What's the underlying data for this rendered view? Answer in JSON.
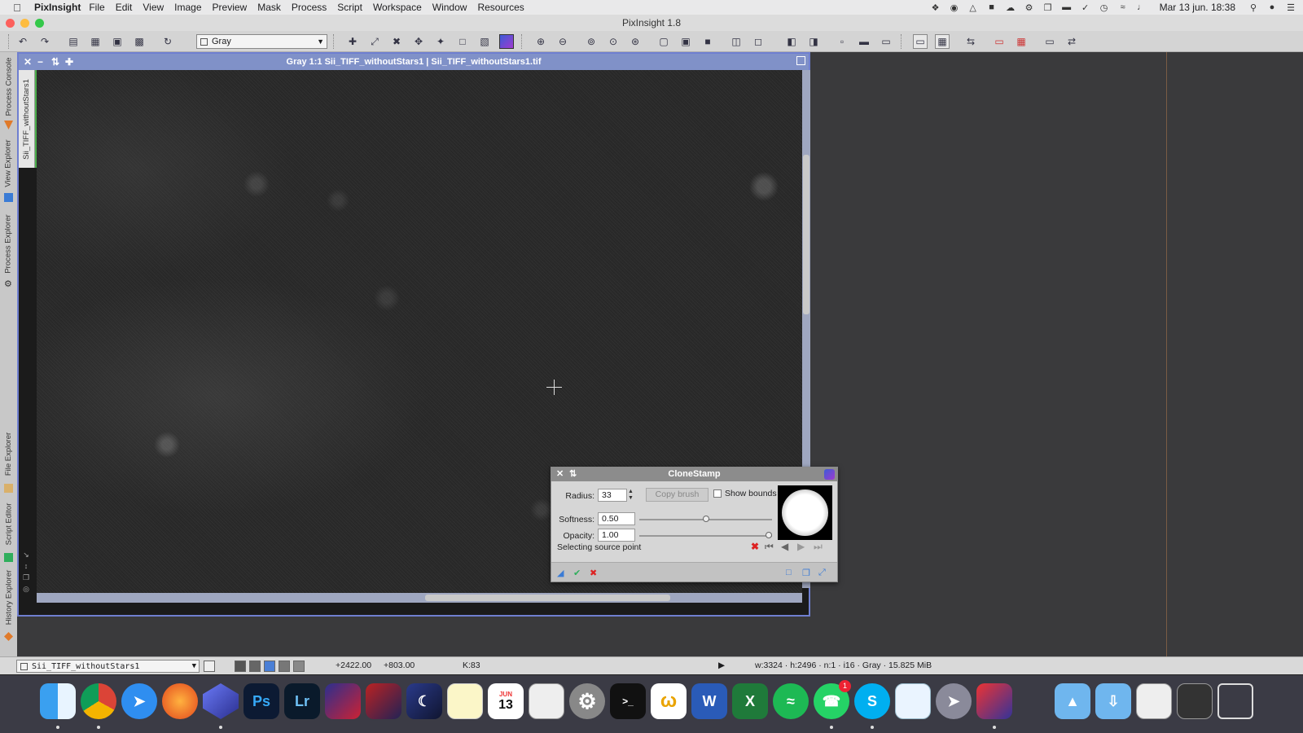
{
  "menubar": {
    "app_name": "PixInsight",
    "items": [
      "File",
      "Edit",
      "View",
      "Image",
      "Preview",
      "Mask",
      "Process",
      "Script",
      "Workspace",
      "Window",
      "Resources"
    ],
    "clock": "Mar 13 jun. 18:38"
  },
  "window": {
    "title": "PixInsight 1.8"
  },
  "toolbar": {
    "view_select_value": "Gray",
    "buttons": [
      "undo-icon",
      "redo-icon",
      "icon-3",
      "icon-4",
      "icon-5",
      "icon-6",
      "icon-7",
      "move-icon",
      "fit-icon",
      "shrink-icon",
      "pan-icon",
      "target-icon",
      "icon-12",
      "icon-13",
      "color-icon",
      "zoom-in-icon",
      "zoom-out-icon",
      "zoom-1-icon",
      "zoom-2-icon",
      "zoom-3-icon",
      "select-icon",
      "icon-21",
      "icon-22",
      "icon-23",
      "icon-24",
      "icon-25",
      "icon-26",
      "icon-27",
      "icon-28",
      "icon-29",
      "screen-icon",
      "screen-2-icon",
      "screen-3-icon",
      "screen-4-icon",
      "screen-5-icon",
      "screen-6-icon",
      "screen-7-icon"
    ]
  },
  "side_tabs": [
    "Process Console",
    "View Explorer",
    "Process Explorer",
    "File Explorer",
    "Script Editor",
    "History Explorer"
  ],
  "image_window": {
    "title": "Gray 1:1 Sii_TIFF_withoutStars1 | Sii_TIFF_withoutStars1.tif",
    "view_tab": "Sii_TIFF_withoutStars1"
  },
  "clonestamp": {
    "title": "CloneStamp",
    "radius_label": "Radius:",
    "radius_value": "33",
    "copy_brush_label": "Copy brush",
    "show_bounds_label": "Show bounds",
    "softness_label": "Softness:",
    "softness_value": "0.50",
    "softness_level": 0.5,
    "opacity_label": "Opacity:",
    "opacity_value": "1.00",
    "opacity_level": 1.0,
    "status": "Selecting source point"
  },
  "statusbar": {
    "view_name": "Sii_TIFF_withoutStars1",
    "x_coord": "+2422.00",
    "y_coord": "+803.00",
    "k_value": "K:83",
    "info": "w:3324 · h:2496 · n:1 · i16 · Gray · 15.825 MiB"
  },
  "dock": {
    "apps": [
      "finder-icon",
      "chrome-icon",
      "safari-icon",
      "firefox-icon",
      "ps-app-icon",
      "photoshop-icon",
      "lightroom-icon",
      "app-8-icon",
      "app-9-icon",
      "app-10-icon",
      "notes-icon",
      "calendar-icon",
      "calculator-icon",
      "preferences-icon",
      "terminal-icon",
      "app-16-icon",
      "word-icon",
      "excel-icon",
      "spotify-icon",
      "whatsapp-icon",
      "skype-icon",
      "app-22-icon",
      "rocket-icon",
      "app-24-icon",
      "applications-folder-icon",
      "downloads-folder-icon",
      "app-27-icon",
      "app-28-icon",
      "trash-icon"
    ],
    "ps_label": "Ps",
    "lr_label": "Lr",
    "word_label": "W",
    "excel_label": "X",
    "skype_label": "S",
    "calendar_month": "JUN",
    "calendar_day": "13",
    "whatsapp_badge": "1"
  }
}
